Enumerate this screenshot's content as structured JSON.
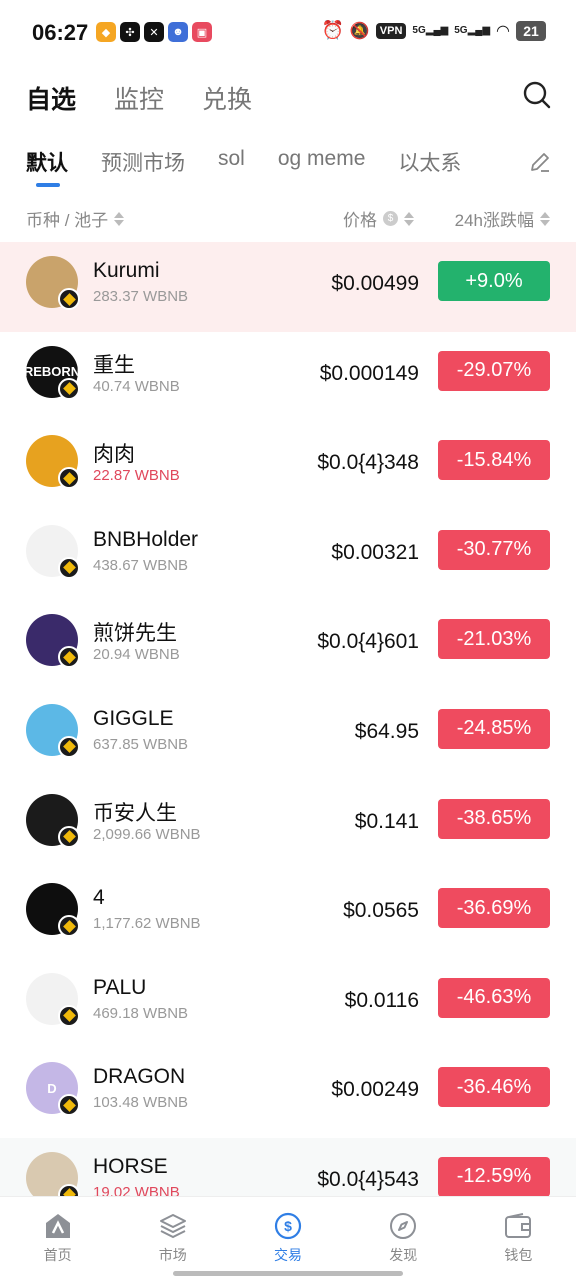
{
  "status_bar": {
    "time": "06:27",
    "vpn": "VPN",
    "signal_1": "5G",
    "signal_2": "5G",
    "battery": "21"
  },
  "top_tabs": [
    {
      "label": "自选",
      "active": true
    },
    {
      "label": "监控",
      "active": false
    },
    {
      "label": "兑换",
      "active": false
    }
  ],
  "sub_tabs": [
    {
      "label": "默认",
      "active": true
    },
    {
      "label": "预测市场",
      "active": false
    },
    {
      "label": "sol",
      "active": false
    },
    {
      "label": "og meme",
      "active": false
    },
    {
      "label": "以太系",
      "active": false
    }
  ],
  "columns": {
    "pair": "币种 / 池子",
    "price": "价格",
    "price_info": "$",
    "change": "24h涨跌幅"
  },
  "tokens": [
    {
      "name": "Kurumi",
      "liquidity": "283.37 WBNB",
      "price": "$0.00499",
      "change": "+9.0%",
      "direction": "up",
      "liq_warn": false,
      "avatar_color": "#c9a36b",
      "avatar_text": ""
    },
    {
      "name": "重生",
      "liquidity": "40.74 WBNB",
      "price": "$0.000149",
      "change": "-29.07%",
      "direction": "down",
      "liq_warn": false,
      "avatar_color": "#111111",
      "avatar_text": "REBORN"
    },
    {
      "name": "肉肉",
      "liquidity": "22.87 WBNB",
      "price": "$0.0{4}348",
      "change": "-15.84%",
      "direction": "down",
      "liq_warn": true,
      "avatar_color": "#e7a21f",
      "avatar_text": ""
    },
    {
      "name": "BNBHolder",
      "liquidity": "438.67 WBNB",
      "price": "$0.00321",
      "change": "-30.77%",
      "direction": "down",
      "liq_warn": false,
      "avatar_color": "#f2f2f2",
      "avatar_text": ""
    },
    {
      "name": "煎饼先生",
      "liquidity": "20.94 WBNB",
      "price": "$0.0{4}601",
      "change": "-21.03%",
      "direction": "down",
      "liq_warn": false,
      "avatar_color": "#3a2a6a",
      "avatar_text": ""
    },
    {
      "name": "GIGGLE",
      "liquidity": "637.85 WBNB",
      "price": "$64.95",
      "change": "-24.85%",
      "direction": "down",
      "liq_warn": false,
      "avatar_color": "#5cb8e6",
      "avatar_text": ""
    },
    {
      "name": "币安人生",
      "liquidity": "2,099.66 WBNB",
      "price": "$0.141",
      "change": "-38.65%",
      "direction": "down",
      "liq_warn": false,
      "avatar_color": "#1b1b1b",
      "avatar_text": ""
    },
    {
      "name": "4",
      "liquidity": "1,177.62 WBNB",
      "price": "$0.0565",
      "change": "-36.69%",
      "direction": "down",
      "liq_warn": false,
      "avatar_color": "#0e0e0e",
      "avatar_text": ""
    },
    {
      "name": "PALU",
      "liquidity": "469.18 WBNB",
      "price": "$0.0116",
      "change": "-46.63%",
      "direction": "down",
      "liq_warn": false,
      "avatar_color": "#f2f2f2",
      "avatar_text": ""
    },
    {
      "name": "DRAGON",
      "liquidity": "103.48 WBNB",
      "price": "$0.00249",
      "change": "-36.46%",
      "direction": "down",
      "liq_warn": false,
      "avatar_color": "#c4b7e6",
      "avatar_text": "D"
    },
    {
      "name": "HORSE",
      "liquidity": "19.02 WBNB",
      "price": "$0.0{4}543",
      "change": "-12.59%",
      "direction": "down",
      "liq_warn": true,
      "avatar_color": "#d9c9b0",
      "avatar_text": ""
    }
  ],
  "bottom_nav": [
    {
      "label": "首页",
      "icon": "home-icon",
      "active": false
    },
    {
      "label": "市场",
      "icon": "layers-icon",
      "active": false
    },
    {
      "label": "交易",
      "icon": "swap-icon",
      "active": true
    },
    {
      "label": "发现",
      "icon": "compass-icon",
      "active": false
    },
    {
      "label": "钱包",
      "icon": "wallet-icon",
      "active": false
    }
  ],
  "colors": {
    "accent": "#2f7ee5",
    "up": "#23b26d",
    "down": "#ef4b5f",
    "highlight_row": "#fdeeee"
  }
}
